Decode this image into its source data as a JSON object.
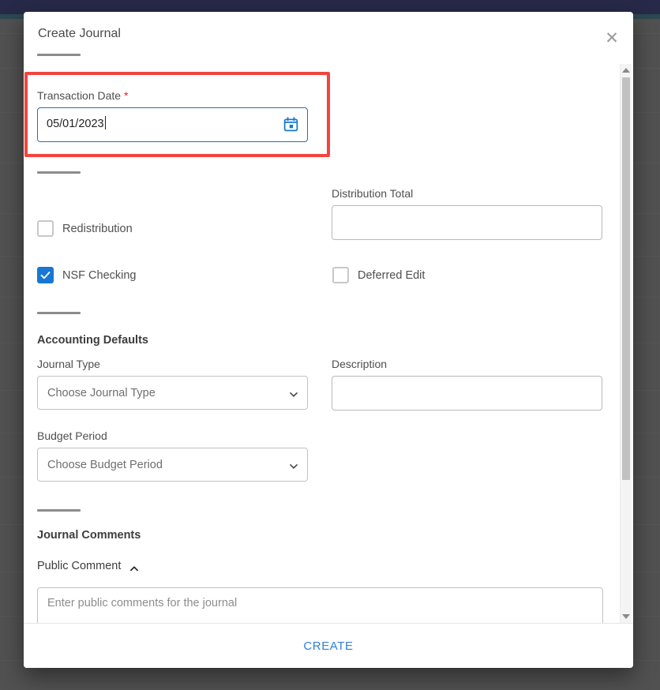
{
  "modal": {
    "title": "Create Journal",
    "close_icon": "close-icon"
  },
  "transaction_date": {
    "label": "Transaction Date",
    "required_marker": "*",
    "value": "05/01/2023",
    "calendar_icon": "calendar-icon"
  },
  "checkboxes": {
    "redistribution": {
      "label": "Redistribution",
      "checked": false
    },
    "nsf_checking": {
      "label": "NSF Checking",
      "checked": true
    },
    "deferred_edit": {
      "label": "Deferred Edit",
      "checked": false
    }
  },
  "distribution_total": {
    "label": "Distribution Total",
    "value": "",
    "placeholder": ""
  },
  "accounting_defaults": {
    "section_title": "Accounting Defaults",
    "journal_type": {
      "label": "Journal Type",
      "selected": "Choose Journal Type"
    },
    "budget_period": {
      "label": "Budget Period",
      "selected": "Choose Budget Period"
    },
    "description": {
      "label": "Description",
      "value": "",
      "placeholder": ""
    }
  },
  "journal_comments": {
    "section_title": "Journal Comments",
    "public_comment": {
      "label": "Public Comment",
      "expanded": true,
      "caret_icon": "chevron-up-icon",
      "value": "",
      "placeholder": "Enter public comments for the journal"
    }
  },
  "footer": {
    "create_label": "CREATE"
  },
  "scrollbar": {
    "up_icon": "scroll-up-arrow-icon",
    "down_icon": "scroll-down-arrow-icon"
  },
  "colors": {
    "accent_blue": "#1877d2",
    "link_blue": "#2f80d8",
    "required_red": "#e02020",
    "highlight_red": "#f2453d",
    "topbar_navy": "#262a5f"
  }
}
